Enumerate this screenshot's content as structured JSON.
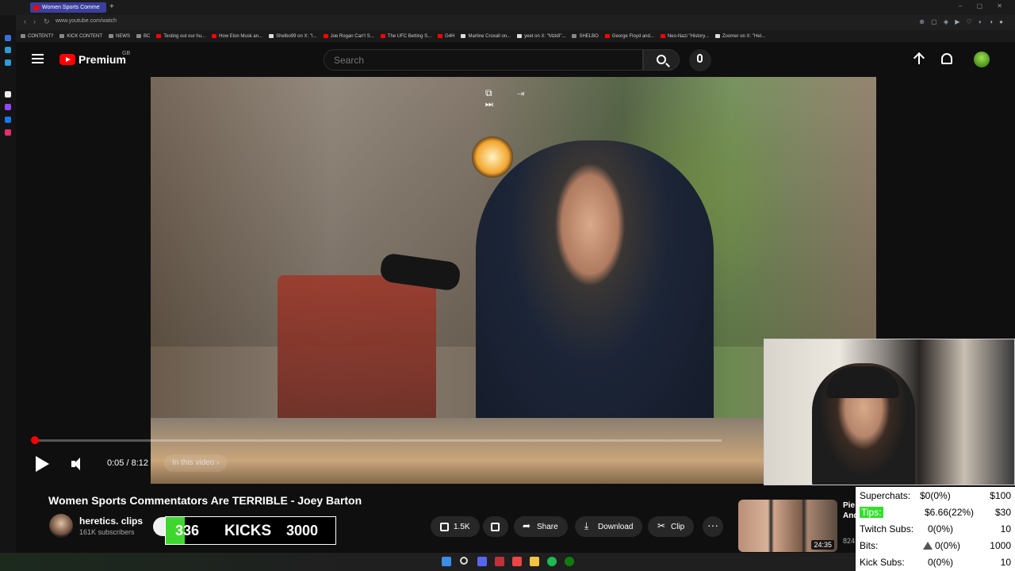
{
  "browser": {
    "tab_title": "Women Sports Comme",
    "new_tab": "+",
    "window_controls": "– ▢ ✕",
    "address": "www.youtube.com/watch",
    "bookmarks": [
      {
        "label": "CONTENT?",
        "color": "#888888"
      },
      {
        "label": "KICK CONTENT",
        "color": "#888888"
      },
      {
        "label": "NEWS",
        "color": "#888888"
      },
      {
        "label": "BC",
        "color": "#888888"
      },
      {
        "label": "Testing out our hu...",
        "color": "#ff0000"
      },
      {
        "label": "How Elon Musk an...",
        "color": "#ff0000"
      },
      {
        "label": "Shelbo99 on X: \"I...",
        "color": "#dddddd"
      },
      {
        "label": "Joe Rogan Can't S...",
        "color": "#ff0000"
      },
      {
        "label": "The UFC Betting S...",
        "color": "#ff0000"
      },
      {
        "label": "G4H",
        "color": "#ff0000"
      },
      {
        "label": "Martine Croxall on...",
        "color": "#dddddd"
      },
      {
        "label": "yeet on X: \"Mzk8\"...",
        "color": "#dddddd"
      },
      {
        "label": "SHELBO",
        "color": "#888888"
      },
      {
        "label": "George Floyd and...",
        "color": "#ff0000"
      },
      {
        "label": "Neo-Nazi \"History...",
        "color": "#ff0000"
      },
      {
        "label": "Zoomer on X: \"Hel...",
        "color": "#dddddd"
      }
    ]
  },
  "header": {
    "logo_text": "Premium",
    "region": "GB",
    "search_placeholder": "Search"
  },
  "player": {
    "time": "0:05 / 8:12",
    "chapters_label": "In this video",
    "progress_fraction": 0.005,
    "top_controls": "⧉ ⇥ ⏭"
  },
  "video": {
    "title": "Women Sports Commentators Are TERRIBLE - Joey Barton",
    "channel_name": "heretics. clips",
    "subscribers": "161K subscribers",
    "likes": "1.5K",
    "share_label": "Share",
    "download_label": "Download",
    "clip_label": "Clip",
    "more_label": "···"
  },
  "kicks": {
    "current": "336",
    "label": "KICKS",
    "goal": "3000",
    "fraction": 0.112
  },
  "recommended": {
    "title": "Pie And",
    "duration": "24:35",
    "meta": "824"
  },
  "overlay": {
    "rows": [
      {
        "label": "Superchats:",
        "value": "$0(0%)",
        "goal": "$100"
      },
      {
        "label": "Tips:",
        "value": "$6.66(22%)",
        "goal": "$30"
      },
      {
        "label": "Twitch Subs:",
        "value": "0(0%)",
        "goal": "10"
      },
      {
        "label": "Bits:",
        "value": "0(0%)",
        "goal": "1000"
      },
      {
        "label": "Kick Subs:",
        "value": "0(0%)",
        "goal": "10"
      }
    ],
    "tips_color": "#32e02a"
  },
  "colors": {
    "youtube_red": "#ff0000",
    "kicks_green": "#3fd630",
    "background": "#0f0f0f"
  }
}
